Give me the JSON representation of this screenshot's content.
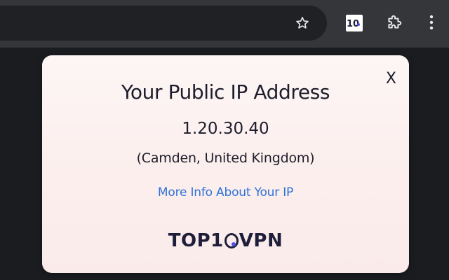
{
  "toolbar": {
    "bookmark_icon": "star-outline-icon",
    "extension_logo_text": "10",
    "extension_logo_icon": "top10vpn-icon",
    "extensions_icon": "puzzle-icon",
    "menu_icon": "three-dots-vertical-icon"
  },
  "popup": {
    "close_label": "X",
    "title": "Your Public IP Address",
    "ip": "1.20.30.40",
    "location": "(Camden, United Kingdom)",
    "more_info_link": "More Info About Your IP",
    "logo": {
      "prefix": "TOP1",
      "suffix": "VPN"
    }
  },
  "colors": {
    "toolbar_bg": "#35363a",
    "omnibox_bg": "#202124",
    "page_bg": "#1b1c20",
    "popup_bg": "#fbeeed",
    "text": "#1d1d2b",
    "link": "#2f72d6",
    "logo_dot": "#4d52e8"
  }
}
